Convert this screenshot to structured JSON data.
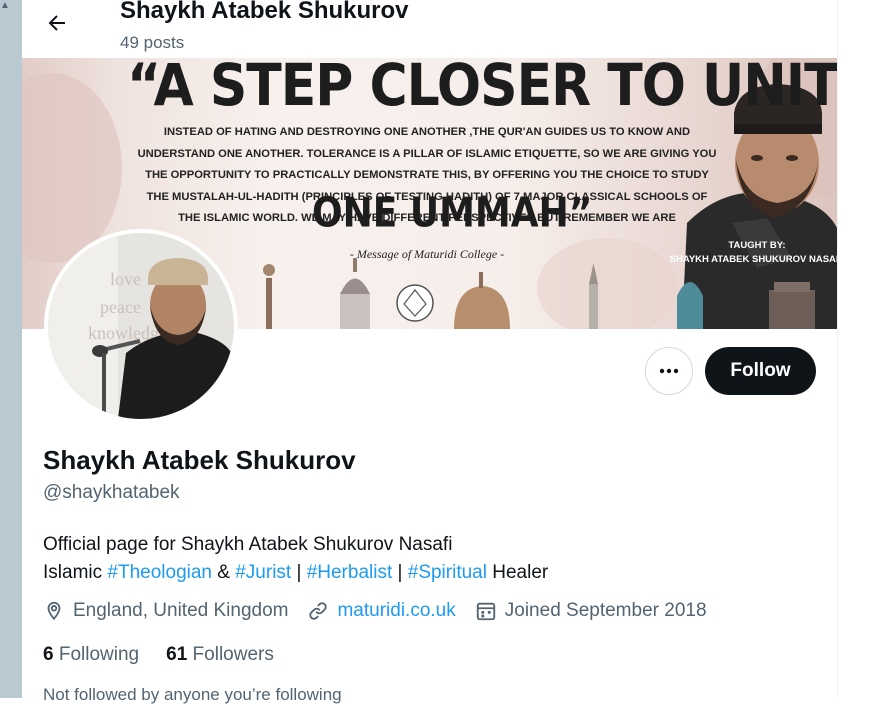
{
  "header": {
    "title": "Shaykh Atabek Shukurov",
    "post_count": "49 posts"
  },
  "banner": {
    "headline": "“A STEP CLOSER TO UNITY...",
    "body": "INSTEAD OF HATING AND DESTROYING ONE ANOTHER ,THE QUR'AN GUIDES US TO KNOW AND UNDERSTAND ONE ANOTHER. TOLERANCE IS A PILLAR OF ISLAMIC ETIQUETTE, SO WE ARE GIVING YOU THE OPPORTUNITY TO PRACTICALLY DEMONSTRATE THIS, BY OFFERING YOU THE CHOICE TO STUDY THE MUSTALAH-UL-HADITH (PRINCIPLES OF TESTING HADITH) OF 7 MAJOR CLASSICAL SCHOOLS OF THE ISLAMIC WORLD. WE MAY HAVE DIFFERENT PERSPECTIVES BUT REMEMBER WE ARE",
    "ummah": "ONE UMMAH”",
    "message": "- Message of Maturidi College -",
    "taught_by": "TAUGHT BY:",
    "taught_name": "SHAYKH ATABEK SHUKUROV NASAFI"
  },
  "avatar": {
    "overlay_words": [
      "love",
      "peace",
      "knowledge"
    ]
  },
  "actions": {
    "follow_label": "Follow"
  },
  "profile": {
    "display_name": "Shaykh Atabek Shukurov",
    "handle": "@shaykhatabek",
    "bio_line1": "Official page for Shaykh Atabek Shukurov Nasafi",
    "bio_line2": {
      "prefix": "Islamic ",
      "tag1": "#Theologian",
      "sep1": " & ",
      "tag2": "#Jurist",
      "sep2": " | ",
      "tag3": "#Herbalist",
      "sep3": " | ",
      "tag4": "#Spiritual",
      "suffix": " Healer"
    },
    "location": "England, United Kingdom",
    "website": "maturidi.co.uk",
    "joined": "Joined September 2018",
    "following_count": "6",
    "following_label": "Following",
    "followers_count": "61",
    "followers_label": "Followers",
    "not_followed_text": "Not followed by anyone you’re following"
  },
  "colors": {
    "accent": "#1d9bf0",
    "text_primary": "#0f1419",
    "text_secondary": "#536471",
    "button_dark": "#0f1419",
    "border": "#cfd9de"
  },
  "icons": [
    "back-arrow-icon",
    "more-icon",
    "location-pin-icon",
    "link-icon",
    "calendar-icon"
  ]
}
